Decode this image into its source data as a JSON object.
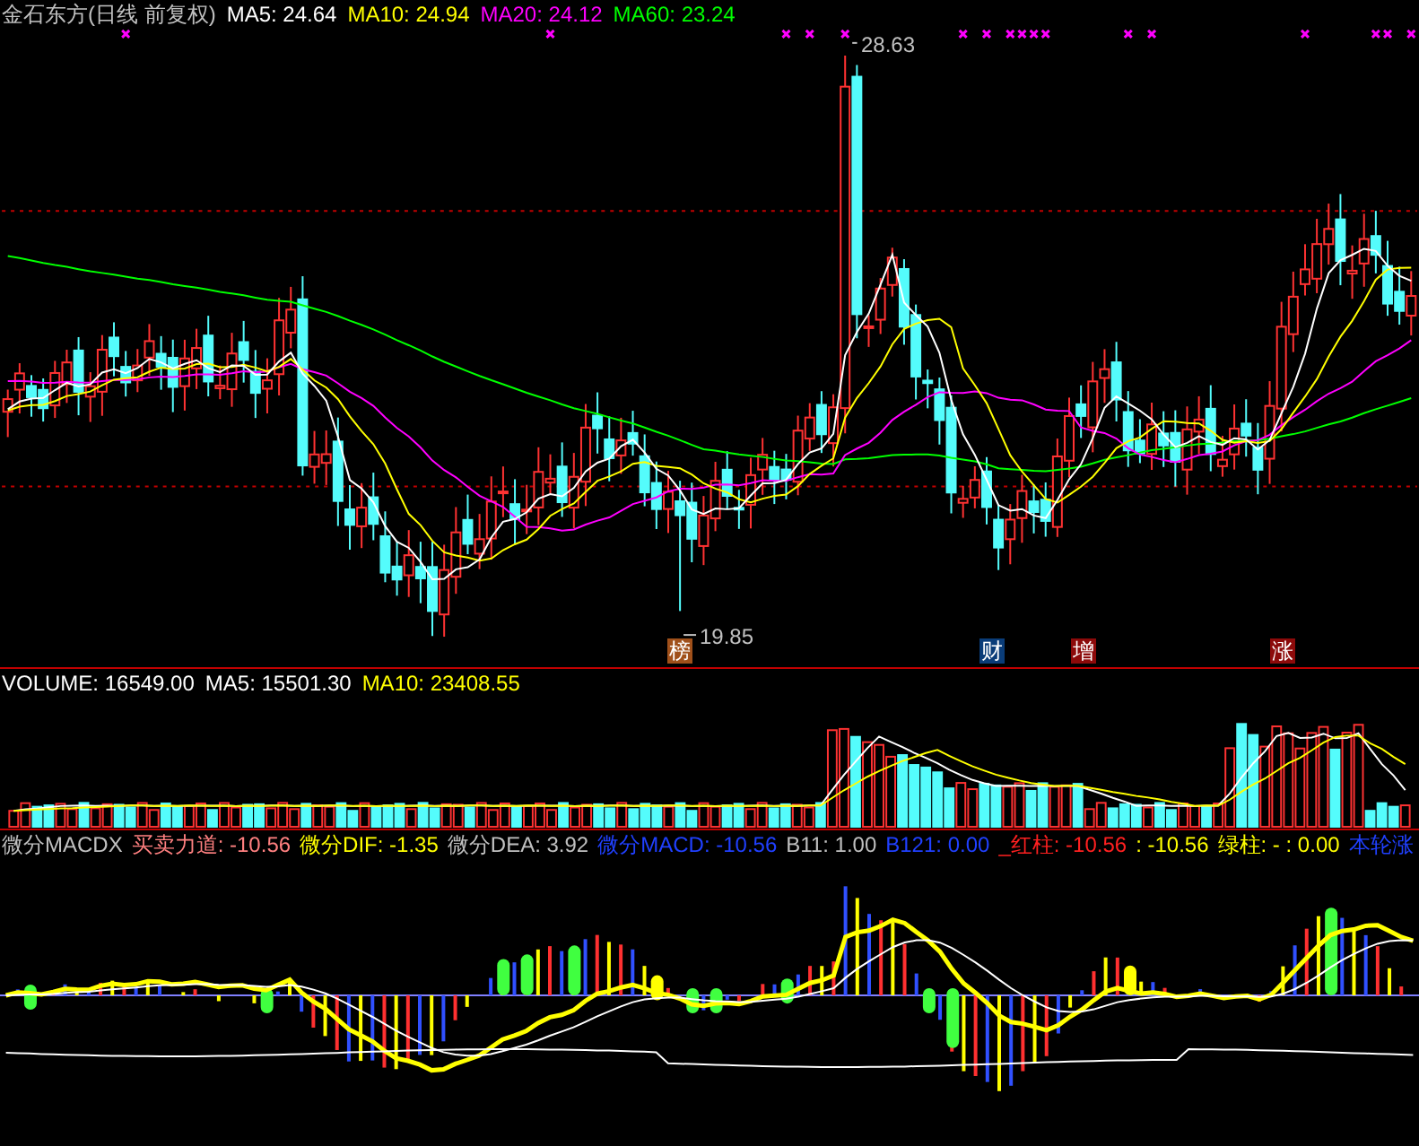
{
  "price_panel": {
    "title": "金石东方(日线 前复权)",
    "legend": [
      {
        "label": "MA5: 24.64",
        "color": "#ffffff"
      },
      {
        "label": "MA10: 24.94",
        "color": "#ffff00"
      },
      {
        "label": "MA20: 24.12",
        "color": "#ff00ff"
      },
      {
        "label": "MA60: 23.24",
        "color": "#00ff00"
      }
    ],
    "high_label": "28.63",
    "low_label": "19.85",
    "badges": [
      {
        "text": "榜",
        "color": "#a0501a"
      },
      {
        "text": "财",
        "color": "#0a3c78"
      },
      {
        "text": "增",
        "color": "#8c0a0a"
      },
      {
        "text": "涨",
        "color": "#8c0a0a"
      }
    ]
  },
  "volume_panel": {
    "legend": [
      {
        "label": "VOLUME: 16549.00",
        "color": "#ffffff"
      },
      {
        "label": "MA5: 15501.30",
        "color": "#ffffff"
      },
      {
        "label": "MA10: 23408.55",
        "color": "#ffff00"
      }
    ]
  },
  "macd_panel": {
    "legend": [
      {
        "label": "微分MACDX",
        "color": "#c0c0c0"
      },
      {
        "label": "买卖力道: -10.56",
        "color": "#ff8080"
      },
      {
        "label": "微分DIF: -1.35",
        "color": "#ffff00"
      },
      {
        "label": "微分DEA: 3.92",
        "color": "#c0c0c0"
      },
      {
        "label": "微分MACD: -10.56",
        "color": "#2040ff"
      },
      {
        "label": "B11: 1.00",
        "color": "#c0c0c0"
      },
      {
        "label": "B121: 0.00",
        "color": "#2040ff"
      },
      {
        "label": "_红柱: -10.56",
        "color": "#ff2020"
      },
      {
        "label": ": -10.56",
        "color": "#ffff00"
      },
      {
        "label": "绿柱: - : 0.00",
        "color": "#ffff00"
      },
      {
        "label": "本轮涨",
        "color": "#2040ff"
      }
    ]
  }
}
